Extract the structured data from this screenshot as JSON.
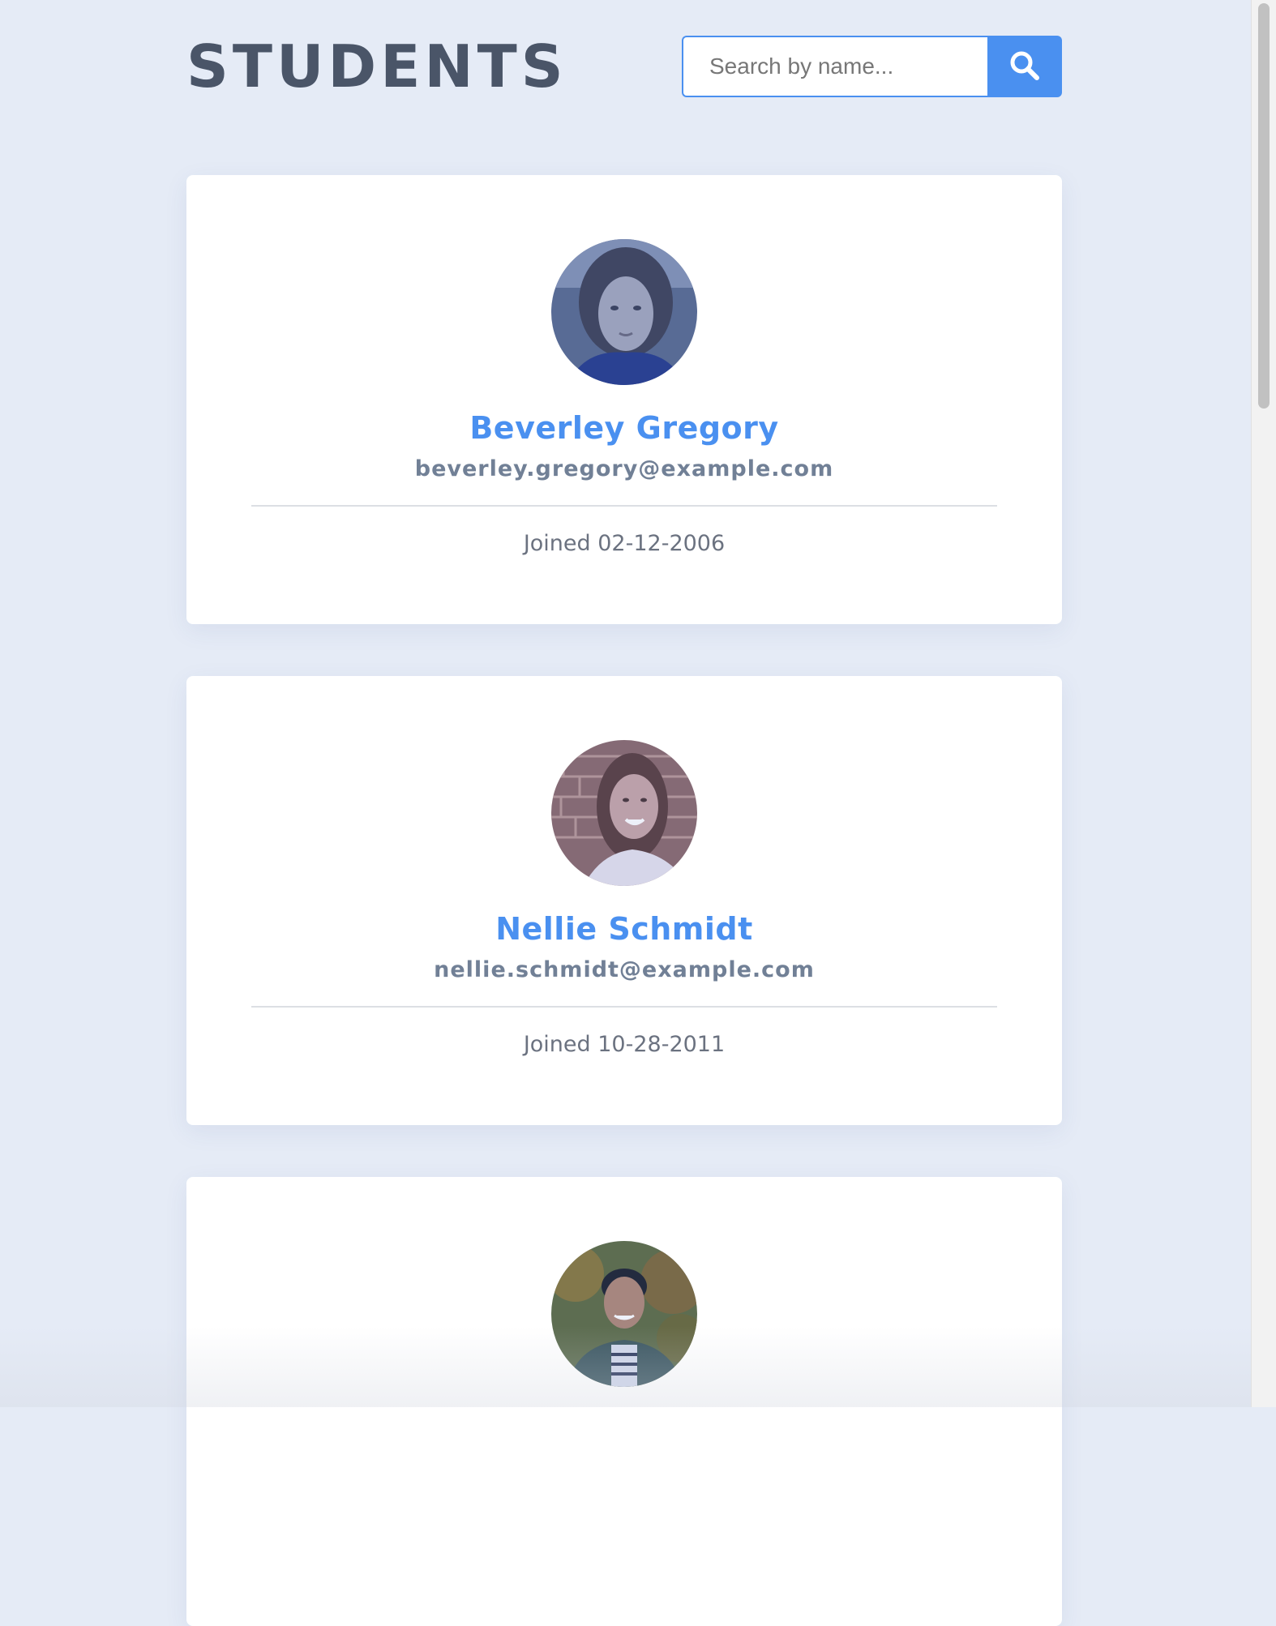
{
  "header": {
    "title": "STUDENTS",
    "search_placeholder": "Search by name...",
    "search_value": "",
    "search_icon": "search-icon"
  },
  "students": [
    {
      "name": "Beverley Gregory",
      "email": "beverley.gregory@example.com",
      "joined": "Joined 02-12-2006",
      "avatar": "avatar-woman-dark-hair-outdoor"
    },
    {
      "name": "Nellie Schmidt",
      "email": "nellie.schmidt@example.com",
      "joined": "Joined 10-28-2011",
      "avatar": "avatar-woman-brick-wall"
    },
    {
      "name": "",
      "email": "",
      "joined": "",
      "avatar": "avatar-man-green-jacket"
    }
  ],
  "colors": {
    "background": "#e5ebf6",
    "accent": "#4a90f0",
    "title": "#4a5568",
    "email": "#718096",
    "joined": "#6b7280",
    "card": "#ffffff"
  }
}
